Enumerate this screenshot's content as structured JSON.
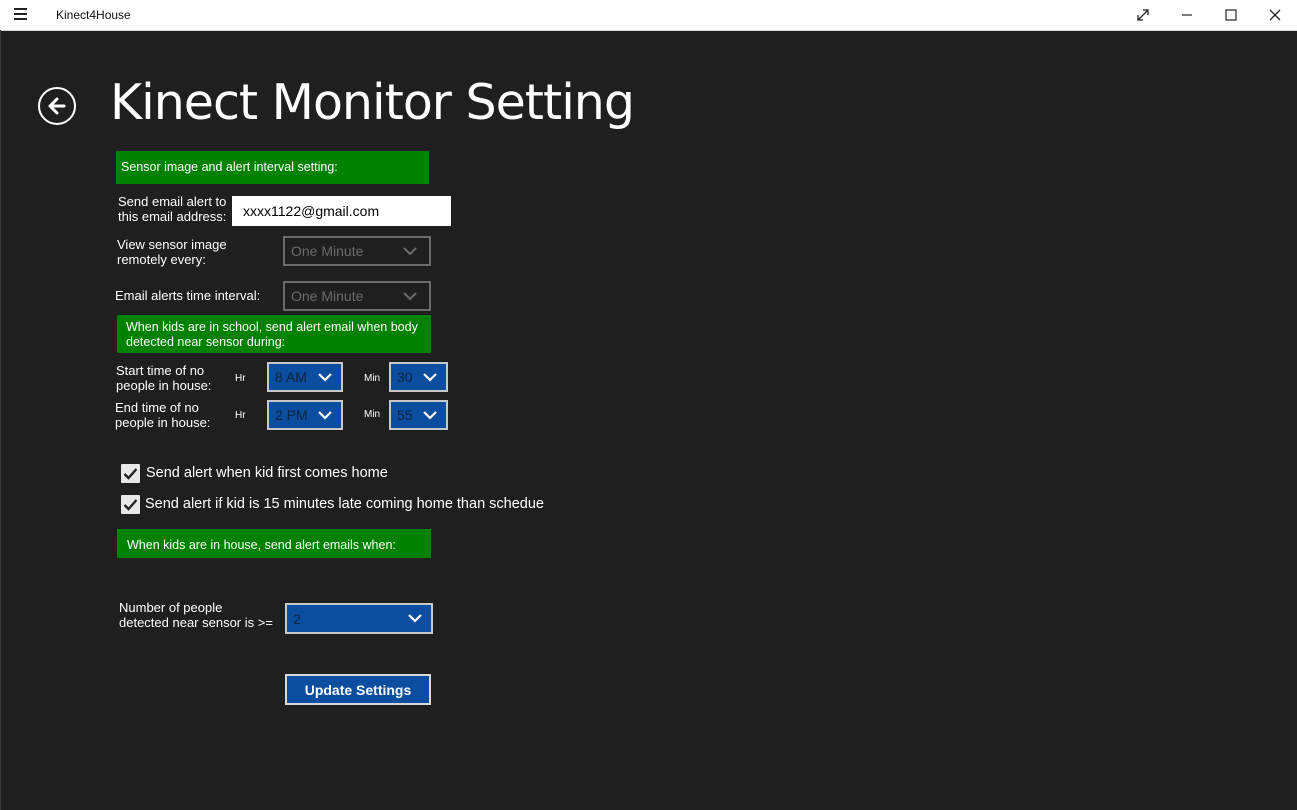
{
  "window": {
    "app_title": "Kinect4House",
    "buttons": [
      "expand-icon",
      "minimize-icon",
      "maximize-icon",
      "close-icon"
    ]
  },
  "page": {
    "title": "Kinect Monitor Setting"
  },
  "sections": {
    "interval_header": "Sensor image and alert interval setting:",
    "school_header": "When kids are in school, send alert email when body detected near sensor during:",
    "house_header": "When kids are in house, send alert emails when:"
  },
  "email": {
    "label_line1": "Send email alert to",
    "label_line2": "this email address:",
    "value": "xxxx1122@gmail.com"
  },
  "view_sensor": {
    "label_line1": "View sensor image",
    "label_line2": "remotely every:",
    "selected": "One Minute"
  },
  "email_interval": {
    "label": "Email alerts time interval:",
    "selected": "One Minute"
  },
  "start_time": {
    "label_line1": "Start time of no",
    "label_line2": "people in house:",
    "hr_label": "Hr",
    "hr_value": "8 AM",
    "min_label": "Min",
    "min_value": "30"
  },
  "end_time": {
    "label_line1": "End time of no",
    "label_line2": "people in house:",
    "hr_label": "Hr",
    "hr_value": "2 PM",
    "min_label": "Min",
    "min_value": "55"
  },
  "checkboxes": {
    "first_home": {
      "label": "Send alert when kid first comes home",
      "checked": true
    },
    "late_home": {
      "label": "Send alert if kid is 15 minutes late coming home than schedue",
      "checked": true
    }
  },
  "people_count": {
    "label_line1": "Number of people",
    "label_line2": "detected near sensor is >=",
    "selected": "2"
  },
  "update_button": {
    "label": "Update Settings"
  },
  "colors": {
    "background": "#1f1f1f",
    "section_green": "#008200",
    "accent_blue": "#0b4d9e",
    "titlebar": "#ffffff"
  }
}
